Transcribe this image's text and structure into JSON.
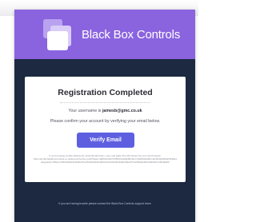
{
  "brand": {
    "name": "Black Box Controls",
    "logo_icon": "stacked-squares-logo",
    "header_color": "#8a63df"
  },
  "email": {
    "title": "Registration Completed",
    "username_prefix": "Your username is",
    "username": "jamesb@gmc.co.uk",
    "confirm_text": "Please confirm your account by verifying your email below.",
    "verify_button_label": "Verify Email",
    "fine_print": [
      "If you're having trouble clicking the Verify Email button, copy and paste the URL below into your web browser:",
      "https://portal.blackboxcontrols.co.uk/account/verify-email?token=a8f3c2e91b7d45f0c6e2a9b8d1f4e7c3a5b9d2e8f1c4a7b0d3e6f9a2c5b8e1d4",
      "&signature=3f9e1c7a5b2d8f4e6c0a9b3d7e1f5c8a2b6d4e0f9c3a7b1d5e8f2c6a0b4d9e3f7c1a5b8d2e6f0c4a9b3d7e1f5c8a2b6"
    ],
    "footer": "If you are having trouble please contact the Black Box Controls support team"
  },
  "colors": {
    "background": "#1c2940",
    "card": "#ffffff",
    "button": "#5e5fe0"
  }
}
